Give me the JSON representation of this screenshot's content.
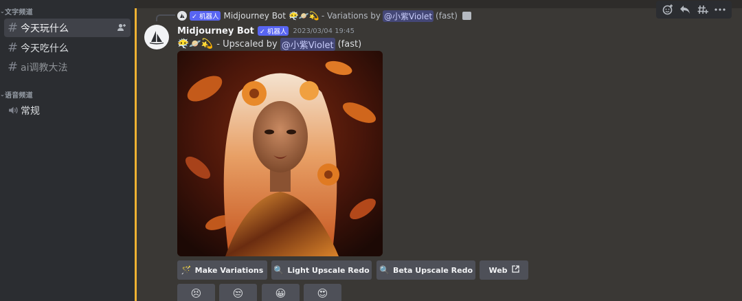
{
  "sidebar": {
    "text_category": "文字频道",
    "voice_category": "语音频道",
    "text_channels": [
      {
        "label": "今天玩什么",
        "active": true
      },
      {
        "label": "今天吃什么",
        "active": false
      },
      {
        "label": "ai调教大法",
        "active": false
      }
    ],
    "voice_channels": [
      {
        "label": "常规"
      }
    ]
  },
  "reply": {
    "bot_badge": "✓ 机器人",
    "author": "Midjourney Bot",
    "emojis": "😶‍🌫️🪐💫",
    "text_before": "- Variations by",
    "mention": "@小紫Violet",
    "text_after": "(fast)"
  },
  "toolbar": {
    "icons": [
      "add-reaction-icon",
      "reply-icon",
      "create-thread-icon",
      "more-icon"
    ]
  },
  "message": {
    "author": "Midjourney Bot",
    "bot_badge": "✓ 机器人",
    "timestamp": "2023/03/04 19:45",
    "emojis": "😶‍🌫️🪐💫",
    "text_before": "- Upscaled by",
    "mention": "@小紫Violet",
    "text_after": "(fast)"
  },
  "buttons": [
    {
      "label": "Make Variations",
      "icon": "🪄"
    },
    {
      "label": "Light Upscale Redo",
      "icon": "🔍"
    },
    {
      "label": "Beta Upscale Redo",
      "icon": "🔍"
    },
    {
      "label": "Web",
      "icon": "external-link-icon"
    }
  ],
  "rating_buttons": [
    "😣",
    "😒",
    "😀",
    "😍"
  ],
  "colors": {
    "accent_bar": "#f0b232",
    "bot_badge": "#5865f2",
    "button": "#4e5058"
  }
}
